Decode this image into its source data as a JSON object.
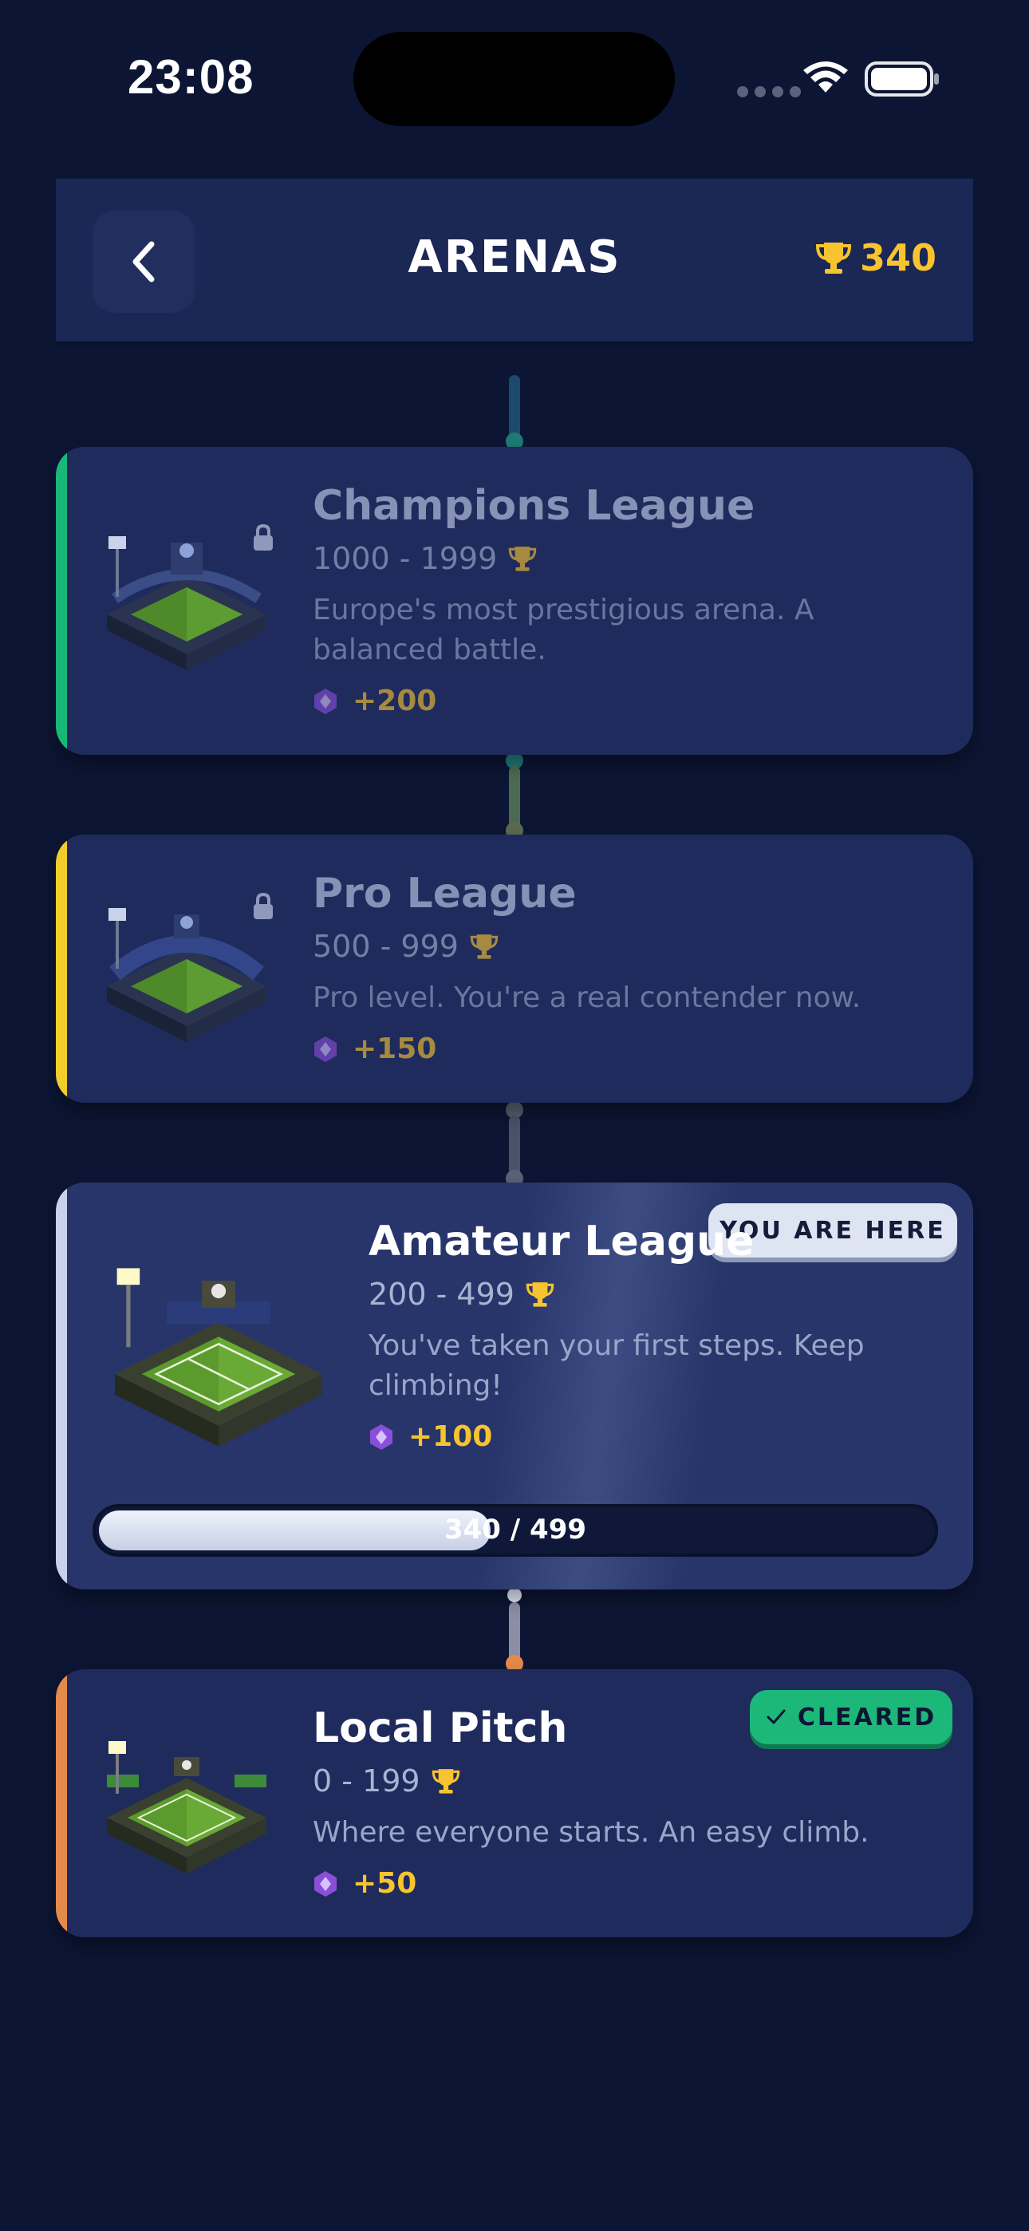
{
  "status_bar": {
    "time": "23:08"
  },
  "header": {
    "title": "ARENAS",
    "trophies": "340"
  },
  "arenas": [
    {
      "name": "Champions League",
      "range": "1000 - 1999",
      "description": "Europe's most prestigious arena. A balanced battle.",
      "reward": "+200",
      "state": "locked",
      "accent_color": "#18b877"
    },
    {
      "name": "Pro League",
      "range": "500 - 999",
      "description": "Pro level. You're a real contender now.",
      "reward": "+150",
      "state": "locked",
      "accent_color": "#f2cd2c"
    },
    {
      "name": "Amateur League",
      "range": "200 - 499",
      "description": "You've taken your first steps. Keep climbing!",
      "reward": "+100",
      "state": "current",
      "badge": "YOU ARE HERE",
      "progress_text": "340 / 499",
      "progress_fraction": 0.47,
      "accent_color": "#c9d2ec"
    },
    {
      "name": "Local Pitch",
      "range": "0 - 199",
      "description": "Where everyone starts. An easy climb.",
      "reward": "+50",
      "state": "cleared",
      "badge": "CLEARED",
      "accent_color": "#e58a4a"
    }
  ],
  "colors": {
    "background": "#0c1533",
    "card": "#1f2b5c",
    "gold": "#f7c42f",
    "gem": "#8a4fd8",
    "cleared_badge": "#1cb87a"
  },
  "icons": [
    "back-icon",
    "trophy-icon",
    "gem-icon",
    "lock-icon",
    "check-icon",
    "wifi-icon",
    "battery-icon",
    "stadium-image"
  ]
}
